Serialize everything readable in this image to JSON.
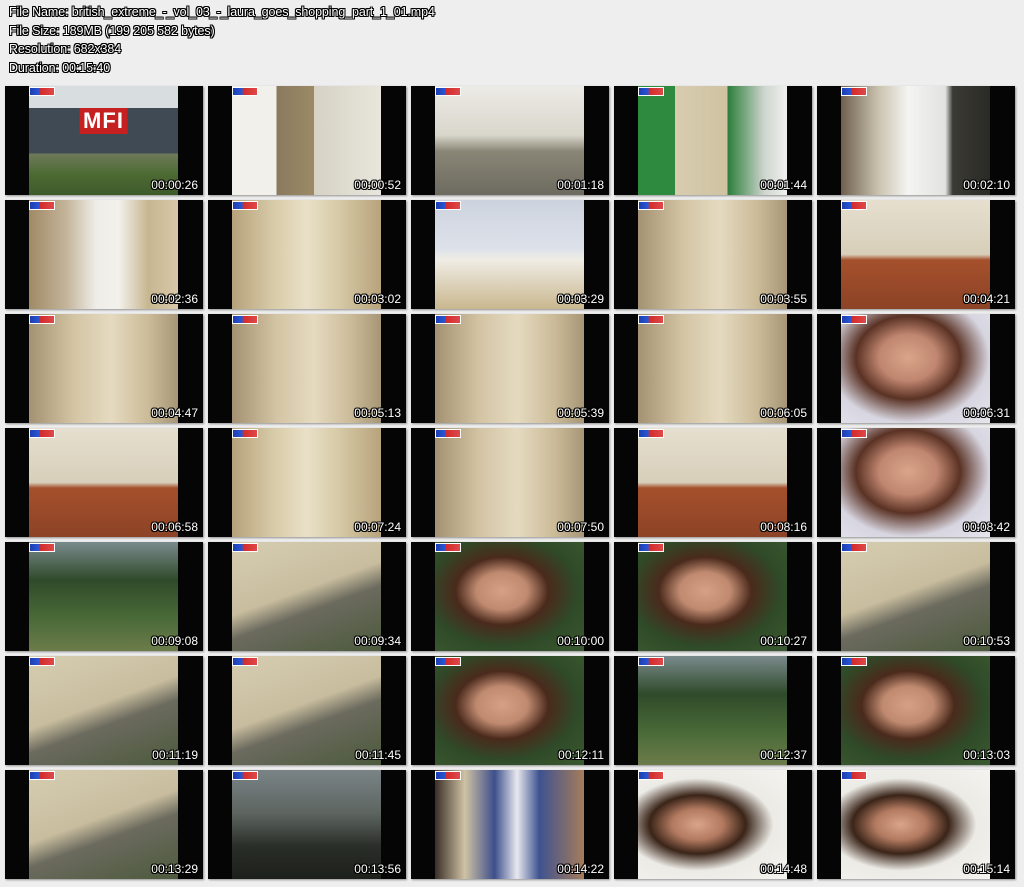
{
  "header": {
    "file_name": "File Name: british_extreme_-_vol_03_-_laura_goes_shopping_part_1_01.mp4",
    "file_size": "File Size: 189MB (199 205 582 bytes)",
    "resolution": "Resolution: 682x384",
    "duration": "Duration: 00:15:40"
  },
  "thumbnails": [
    {
      "timestamp": "00:00:26",
      "scene": "store-exterior",
      "logo_text": "MFI"
    },
    {
      "timestamp": "00:00:52",
      "scene": "kitchen-showroom"
    },
    {
      "timestamp": "00:01:18",
      "scene": "showroom-floor"
    },
    {
      "timestamp": "00:01:44",
      "scene": "legs-sign"
    },
    {
      "timestamp": "00:02:10",
      "scene": "showroom-window"
    },
    {
      "timestamp": "00:02:36",
      "scene": "woman-in-kitchen"
    },
    {
      "timestamp": "00:03:02",
      "scene": "torso-trousers"
    },
    {
      "timestamp": "00:03:29",
      "scene": "woman-standing"
    },
    {
      "timestamp": "00:03:55",
      "scene": "trousers-closeup"
    },
    {
      "timestamp": "00:04:21",
      "scene": "legs-floor"
    },
    {
      "timestamp": "00:04:47",
      "scene": "trousers-closeup"
    },
    {
      "timestamp": "00:05:13",
      "scene": "trousers-closeup"
    },
    {
      "timestamp": "00:05:39",
      "scene": "trousers-closeup"
    },
    {
      "timestamp": "00:06:05",
      "scene": "trousers-closeup"
    },
    {
      "timestamp": "00:06:31",
      "scene": "face-closeup"
    },
    {
      "timestamp": "00:06:58",
      "scene": "legs-floor"
    },
    {
      "timestamp": "00:07:24",
      "scene": "torso-trousers"
    },
    {
      "timestamp": "00:07:50",
      "scene": "trousers-closeup"
    },
    {
      "timestamp": "00:08:16",
      "scene": "legs-floor"
    },
    {
      "timestamp": "00:08:42",
      "scene": "face-closeup"
    },
    {
      "timestamp": "00:09:08",
      "scene": "outdoor-person"
    },
    {
      "timestamp": "00:09:34",
      "scene": "outdoor-trousers"
    },
    {
      "timestamp": "00:10:00",
      "scene": "outdoor-face"
    },
    {
      "timestamp": "00:10:27",
      "scene": "outdoor-face"
    },
    {
      "timestamp": "00:10:53",
      "scene": "outdoor-trousers"
    },
    {
      "timestamp": "00:11:19",
      "scene": "outdoor-trousers"
    },
    {
      "timestamp": "00:11:45",
      "scene": "outdoor-trousers"
    },
    {
      "timestamp": "00:12:11",
      "scene": "outdoor-face"
    },
    {
      "timestamp": "00:12:37",
      "scene": "outdoor-person"
    },
    {
      "timestamp": "00:13:03",
      "scene": "outdoor-face"
    },
    {
      "timestamp": "00:13:29",
      "scene": "outdoor-trousers"
    },
    {
      "timestamp": "00:13:56",
      "scene": "dark-outdoor"
    },
    {
      "timestamp": "00:14:22",
      "scene": "legs-armchair"
    },
    {
      "timestamp": "00:14:48",
      "scene": "indoor-face"
    },
    {
      "timestamp": "00:15:14",
      "scene": "indoor-face"
    }
  ]
}
